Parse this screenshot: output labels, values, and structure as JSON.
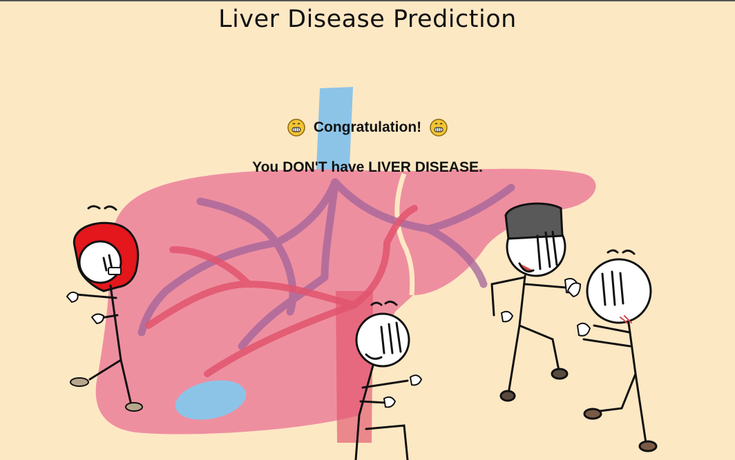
{
  "page": {
    "title": "Liver Disease Prediction"
  },
  "result": {
    "headline": "Congratulation!",
    "message": "You DON'T have LIVER DISEASE.",
    "emoji_icon": "grinning-face-icon"
  },
  "colors": {
    "background": "#fde8c4",
    "liver": "#ee8fa0",
    "vessel_blue": "#8cc4e8",
    "vein_red": "#e2556e",
    "vein_purple": "#a2649a",
    "hair_red": "#e3171c",
    "ink": "#111111"
  },
  "illustration": {
    "name": "liver-celebration-illustration"
  }
}
